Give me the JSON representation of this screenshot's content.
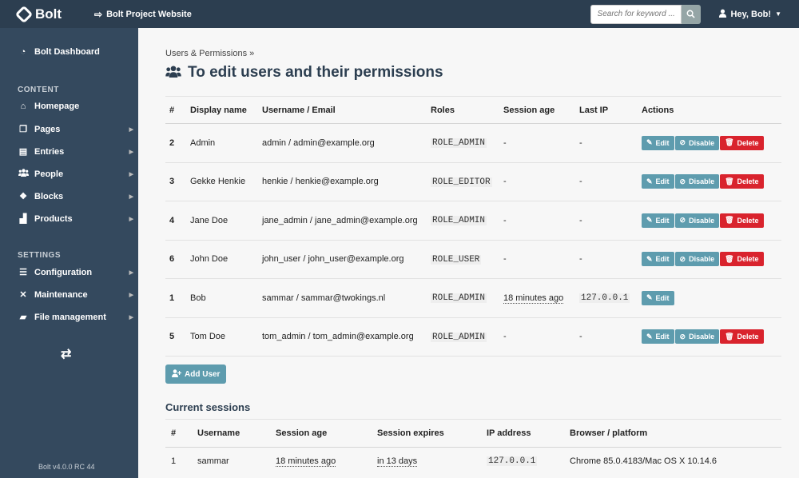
{
  "topbar": {
    "brand": "Bolt",
    "site_link": "Bolt Project Website",
    "search_placeholder": "Search for keyword ...",
    "user_greeting": "Hey, Bob!"
  },
  "sidebar": {
    "dashboard": "Bolt Dashboard",
    "content_heading": "CONTENT",
    "content_items": [
      {
        "label": "Homepage",
        "icon": "home-icon",
        "has_submenu": false
      },
      {
        "label": "Pages",
        "icon": "copy-icon",
        "has_submenu": true
      },
      {
        "label": "Entries",
        "icon": "file-icon",
        "has_submenu": true
      },
      {
        "label": "People",
        "icon": "users-icon",
        "has_submenu": true
      },
      {
        "label": "Blocks",
        "icon": "cubes-icon",
        "has_submenu": true
      },
      {
        "label": "Products",
        "icon": "industry-icon",
        "has_submenu": true
      }
    ],
    "settings_heading": "SETTINGS",
    "settings_items": [
      {
        "label": "Configuration",
        "icon": "sliders-icon",
        "has_submenu": true
      },
      {
        "label": "Maintenance",
        "icon": "tools-icon",
        "has_submenu": true
      },
      {
        "label": "File management",
        "icon": "folder-icon",
        "has_submenu": true
      }
    ],
    "version": "Bolt v4.0.0 RC 44"
  },
  "main": {
    "breadcrumb": "Users & Permissions »",
    "title": "To edit users and their permissions",
    "users_table": {
      "headers": [
        "#",
        "Display name",
        "Username / Email",
        "Roles",
        "Session age",
        "Last IP",
        "Actions"
      ],
      "rows": [
        {
          "id": "2",
          "display_name": "Admin",
          "username_email": "admin / admin@example.org",
          "role": "ROLE_ADMIN",
          "session_age": "-",
          "last_ip": "-",
          "is_current": false
        },
        {
          "id": "3",
          "display_name": "Gekke Henkie",
          "username_email": "henkie / henkie@example.org",
          "role": "ROLE_EDITOR",
          "session_age": "-",
          "last_ip": "-",
          "is_current": false
        },
        {
          "id": "4",
          "display_name": "Jane Doe",
          "username_email": "jane_admin / jane_admin@example.org",
          "role": "ROLE_ADMIN",
          "session_age": "-",
          "last_ip": "-",
          "is_current": false
        },
        {
          "id": "6",
          "display_name": "John Doe",
          "username_email": "john_user / john_user@example.org",
          "role": "ROLE_USER",
          "session_age": "-",
          "last_ip": "-",
          "is_current": false
        },
        {
          "id": "1",
          "display_name": "Bob",
          "username_email": "sammar / sammar@twokings.nl",
          "role": "ROLE_ADMIN",
          "session_age": "18 minutes ago",
          "last_ip": "127.0.0.1",
          "is_current": true
        },
        {
          "id": "5",
          "display_name": "Tom Doe",
          "username_email": "tom_admin / tom_admin@example.org",
          "role": "ROLE_ADMIN",
          "session_age": "-",
          "last_ip": "-",
          "is_current": false
        }
      ],
      "actions": {
        "edit": "Edit",
        "disable": "Disable",
        "delete": "Delete"
      }
    },
    "add_user": "Add User",
    "sessions_title": "Current sessions",
    "sessions_table": {
      "headers": [
        "#",
        "Username",
        "Session age",
        "Session expires",
        "IP address",
        "Browser / platform"
      ],
      "rows": [
        {
          "id": "1",
          "username": "sammar",
          "session_age": "18 minutes ago",
          "expires": "in 13 days",
          "ip": "127.0.0.1",
          "browser": "Chrome 85.0.4183/Mac OS X 10.14.6"
        }
      ]
    }
  },
  "colors": {
    "topbar": "#2c3e50",
    "sidebar": "#34495e",
    "button_info": "#5e9cae",
    "button_danger": "#d9232d"
  }
}
